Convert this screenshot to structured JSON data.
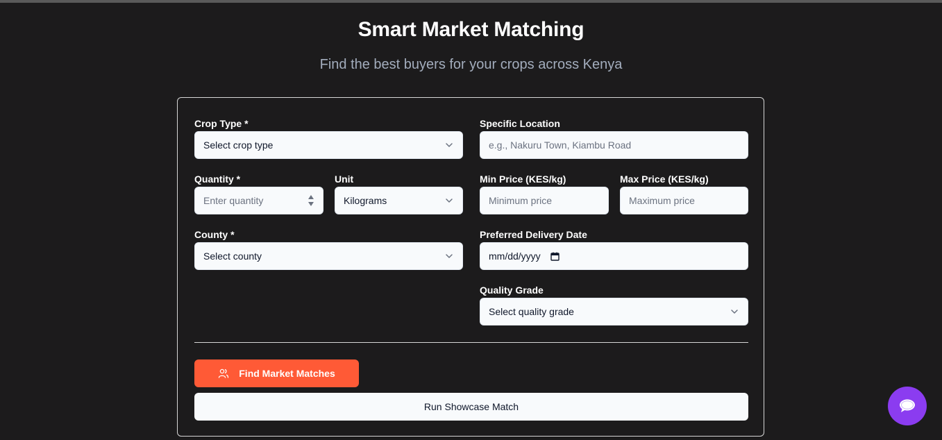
{
  "header": {
    "title": "Smart Market Matching",
    "subtitle": "Find the best buyers for your crops across Kenya"
  },
  "form": {
    "crop_type": {
      "label": "Crop Type *",
      "value": "Select crop type"
    },
    "specific_location": {
      "label": "Specific Location",
      "placeholder": "e.g., Nakuru Town, Kiambu Road"
    },
    "quantity": {
      "label": "Quantity *",
      "placeholder": "Enter quantity"
    },
    "unit": {
      "label": "Unit",
      "value": "Kilograms"
    },
    "min_price": {
      "label": "Min Price (KES/kg)",
      "placeholder": "Minimum price"
    },
    "max_price": {
      "label": "Max Price (KES/kg)",
      "placeholder": "Maximum price"
    },
    "county": {
      "label": "County *",
      "value": "Select county"
    },
    "delivery_date": {
      "label": "Preferred Delivery Date",
      "value": "mm/dd/yyyy"
    },
    "quality_grade": {
      "label": "Quality Grade",
      "value": "Select quality grade"
    }
  },
  "actions": {
    "find_matches_label": "Find Market Matches",
    "find_matches_icon": "users-icon",
    "showcase_label": "Run Showcase Match"
  },
  "chat": {
    "icon": "chat-bubble-icon"
  },
  "colors": {
    "background": "#1c1b1c",
    "primary_button": "#ff5a36",
    "chat_button": "#8b3cf0",
    "field_background": "#f8fafc",
    "subtitle": "#a3adbd"
  }
}
